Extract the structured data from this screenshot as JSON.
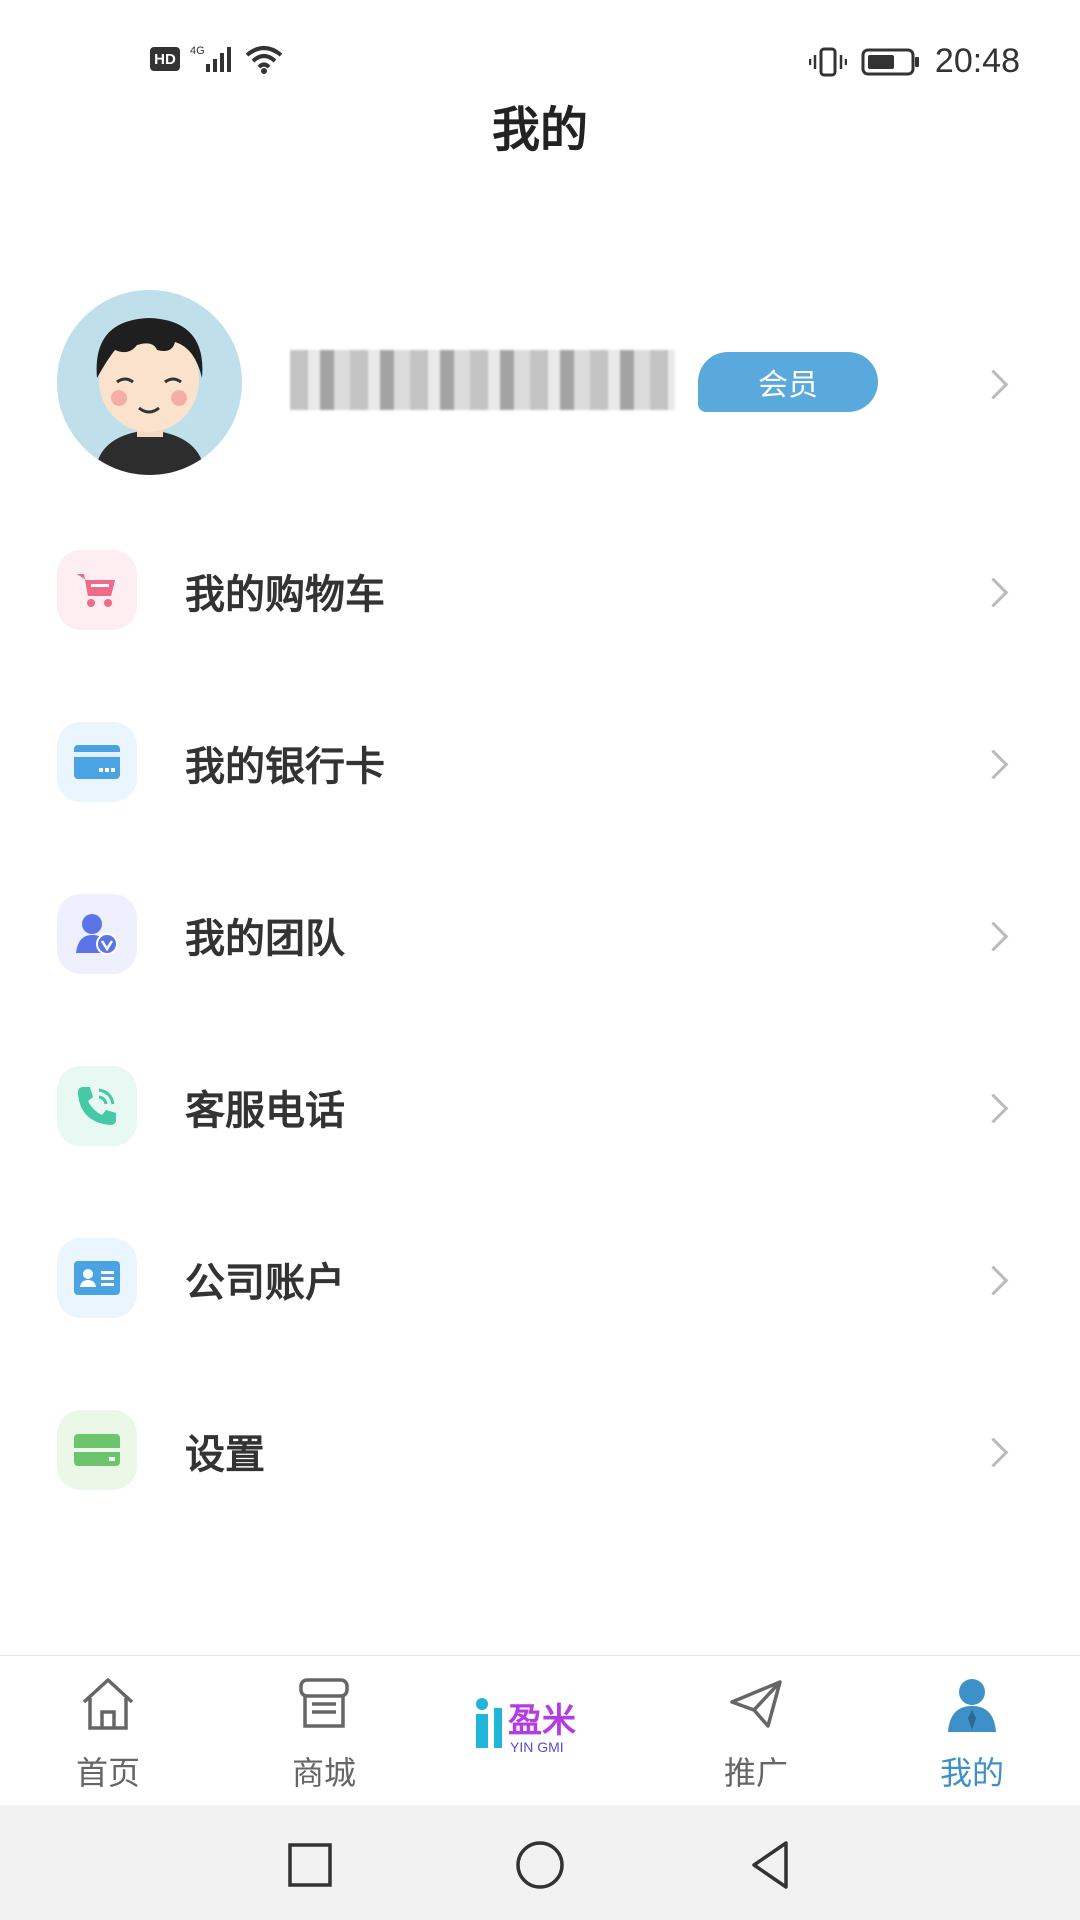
{
  "status_bar": {
    "hd": "HD",
    "network": "4G",
    "time": "20:48"
  },
  "header": {
    "title": "我的"
  },
  "profile": {
    "member_badge": "会员"
  },
  "menu": [
    {
      "label": "我的购物车",
      "icon": "cart-icon",
      "color": "#f06a8a",
      "bg": "#fdeef2"
    },
    {
      "label": "我的银行卡",
      "icon": "bank-card-icon",
      "color": "#4aa4e4",
      "bg": "#eaf5fd"
    },
    {
      "label": "我的团队",
      "icon": "team-icon",
      "color": "#5b74e8",
      "bg": "#eef0fd"
    },
    {
      "label": "客服电话",
      "icon": "phone-icon",
      "color": "#45c9a6",
      "bg": "#e8f8f3"
    },
    {
      "label": "公司账户",
      "icon": "company-account-icon",
      "color": "#4aa4e4",
      "bg": "#eaf5fd"
    },
    {
      "label": "设置",
      "icon": "settings-icon",
      "color": "#6cc46c",
      "bg": "#ebf8e8"
    }
  ],
  "tabs": [
    {
      "label": "首页",
      "icon": "home-icon"
    },
    {
      "label": "商城",
      "icon": "store-icon"
    },
    {
      "label": "",
      "icon": "yinmi-logo",
      "logo_text": "盈米",
      "logo_sub": "YIN GMI"
    },
    {
      "label": "推广",
      "icon": "paper-plane-icon"
    },
    {
      "label": "我的",
      "icon": "user-icon",
      "active": true
    }
  ],
  "colors": {
    "accent": "#3d90c8",
    "badge": "#5aa9dc"
  }
}
